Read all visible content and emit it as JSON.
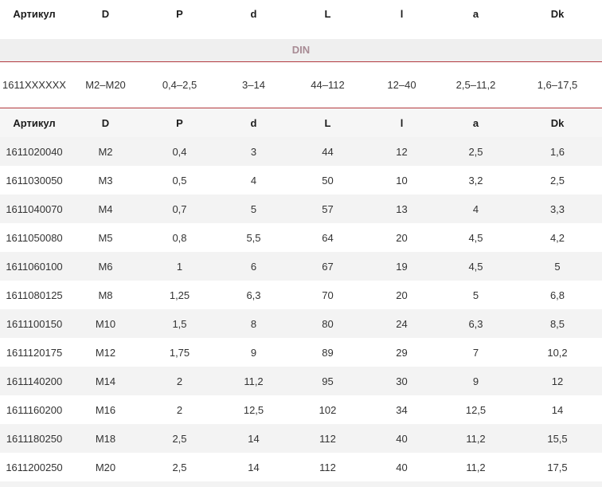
{
  "columns": [
    "Артикул",
    "D",
    "P",
    "d",
    "L",
    "l",
    "a",
    "Dk"
  ],
  "group_label": "DIN",
  "summary": [
    "1611XXXXXX",
    "M2–M20",
    "0,4–2,5",
    "3–14",
    "44–112",
    "12–40",
    "2,5–11,2",
    "1,6–17,5"
  ],
  "rows": [
    [
      "1611020040",
      "M2",
      "0,4",
      "3",
      "44",
      "12",
      "2,5",
      "1,6"
    ],
    [
      "1611030050",
      "M3",
      "0,5",
      "4",
      "50",
      "10",
      "3,2",
      "2,5"
    ],
    [
      "1611040070",
      "M4",
      "0,7",
      "5",
      "57",
      "13",
      "4",
      "3,3"
    ],
    [
      "1611050080",
      "M5",
      "0,8",
      "5,5",
      "64",
      "20",
      "4,5",
      "4,2"
    ],
    [
      "1611060100",
      "M6",
      "1",
      "6",
      "67",
      "19",
      "4,5",
      "5"
    ],
    [
      "1611080125",
      "M8",
      "1,25",
      "6,3",
      "70",
      "20",
      "5",
      "6,8"
    ],
    [
      "1611100150",
      "M10",
      "1,5",
      "8",
      "80",
      "24",
      "6,3",
      "8,5"
    ],
    [
      "1611120175",
      "M12",
      "1,75",
      "9",
      "89",
      "29",
      "7",
      "10,2"
    ],
    [
      "1611140200",
      "M14",
      "2",
      "11,2",
      "95",
      "30",
      "9",
      "12"
    ],
    [
      "1611160200",
      "M16",
      "2",
      "12,5",
      "102",
      "34",
      "12,5",
      "14"
    ],
    [
      "1611180250",
      "M18",
      "2,5",
      "14",
      "112",
      "40",
      "11,2",
      "15,5"
    ],
    [
      "1611200250",
      "M20",
      "2,5",
      "14",
      "112",
      "40",
      "11,2",
      "17,5"
    ]
  ]
}
